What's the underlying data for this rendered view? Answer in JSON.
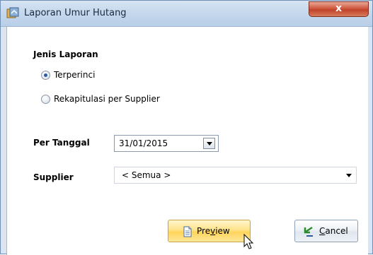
{
  "window": {
    "title": "Laporan Umur Hutang",
    "close_label": "x"
  },
  "jenis_laporan": {
    "title": "Jenis Laporan",
    "options": [
      {
        "label": "Terperinci",
        "checked": true
      },
      {
        "label": "Rekapitulasi per Supplier",
        "checked": false
      }
    ]
  },
  "per_tanggal": {
    "label": "Per Tanggal",
    "value": "31/01/2015"
  },
  "supplier": {
    "label": "Supplier",
    "value": "< Semua >"
  },
  "buttons": {
    "preview": {
      "pre": "Pre",
      "mnemonic": "v",
      "post": "iew",
      "icon": "document-icon"
    },
    "cancel": {
      "mnemonic": "C",
      "post": "ancel",
      "icon": "undo-arrow-icon"
    }
  },
  "colors": {
    "titlebar": "#c3d6ec",
    "close": "#c1432b",
    "preview_button": "#ffd45a"
  }
}
